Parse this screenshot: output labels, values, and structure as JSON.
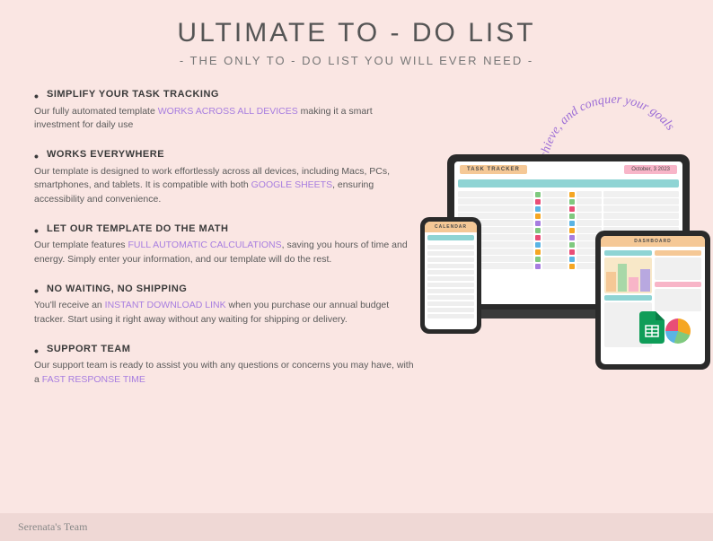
{
  "header": {
    "title": "ULTIMATE TO - DO LIST",
    "subtitle": "- THE ONLY TO - DO LIST YOU WILL EVER NEED -"
  },
  "features": [
    {
      "title": "SIMPLIFY YOUR TASK TRACKING",
      "pre": "Our fully automated template ",
      "hl": "WORKS ACROSS ALL DEVICES",
      "post": " making it a smart investment for daily use"
    },
    {
      "title": "WORKS EVERYWHERE",
      "pre": "Our template is designed to work effortlessly across all devices, including Macs, PCs, smartphones, and tablets. It is compatible with both ",
      "hl": "GOOGLE SHEETS",
      "post": ", ensuring accessibility and convenience."
    },
    {
      "title": "LET OUR TEMPLATE DO THE MATH",
      "pre": "Our template features ",
      "hl": "FULL AUTOMATIC CALCULATIONS",
      "post": ", saving you hours of time and energy. Simply enter your information, and our template will do the rest."
    },
    {
      "title": "NO WAITING, NO SHIPPING",
      "pre": "You'll receive an ",
      "hl": "INSTANT DOWNLOAD LINK",
      "post": " when you purchase our annual budget tracker. Start using it right away without any waiting for shipping or delivery."
    },
    {
      "title": "SUPPORT TEAM",
      "pre": "Our support team is ready to assist you with any questions or concerns you may have, with a ",
      "hl": "FAST RESPONSE TIME",
      "post": ""
    }
  ],
  "curved_text": "Plan, achieve, and conquer your goals",
  "mockup": {
    "tracker_label": "TASK TRACKER",
    "tracker_date": "October, 3 2023",
    "calendar_label": "CALENDAR",
    "dashboard_label": "DASHBOARD"
  },
  "footer": "Serenata's Team"
}
